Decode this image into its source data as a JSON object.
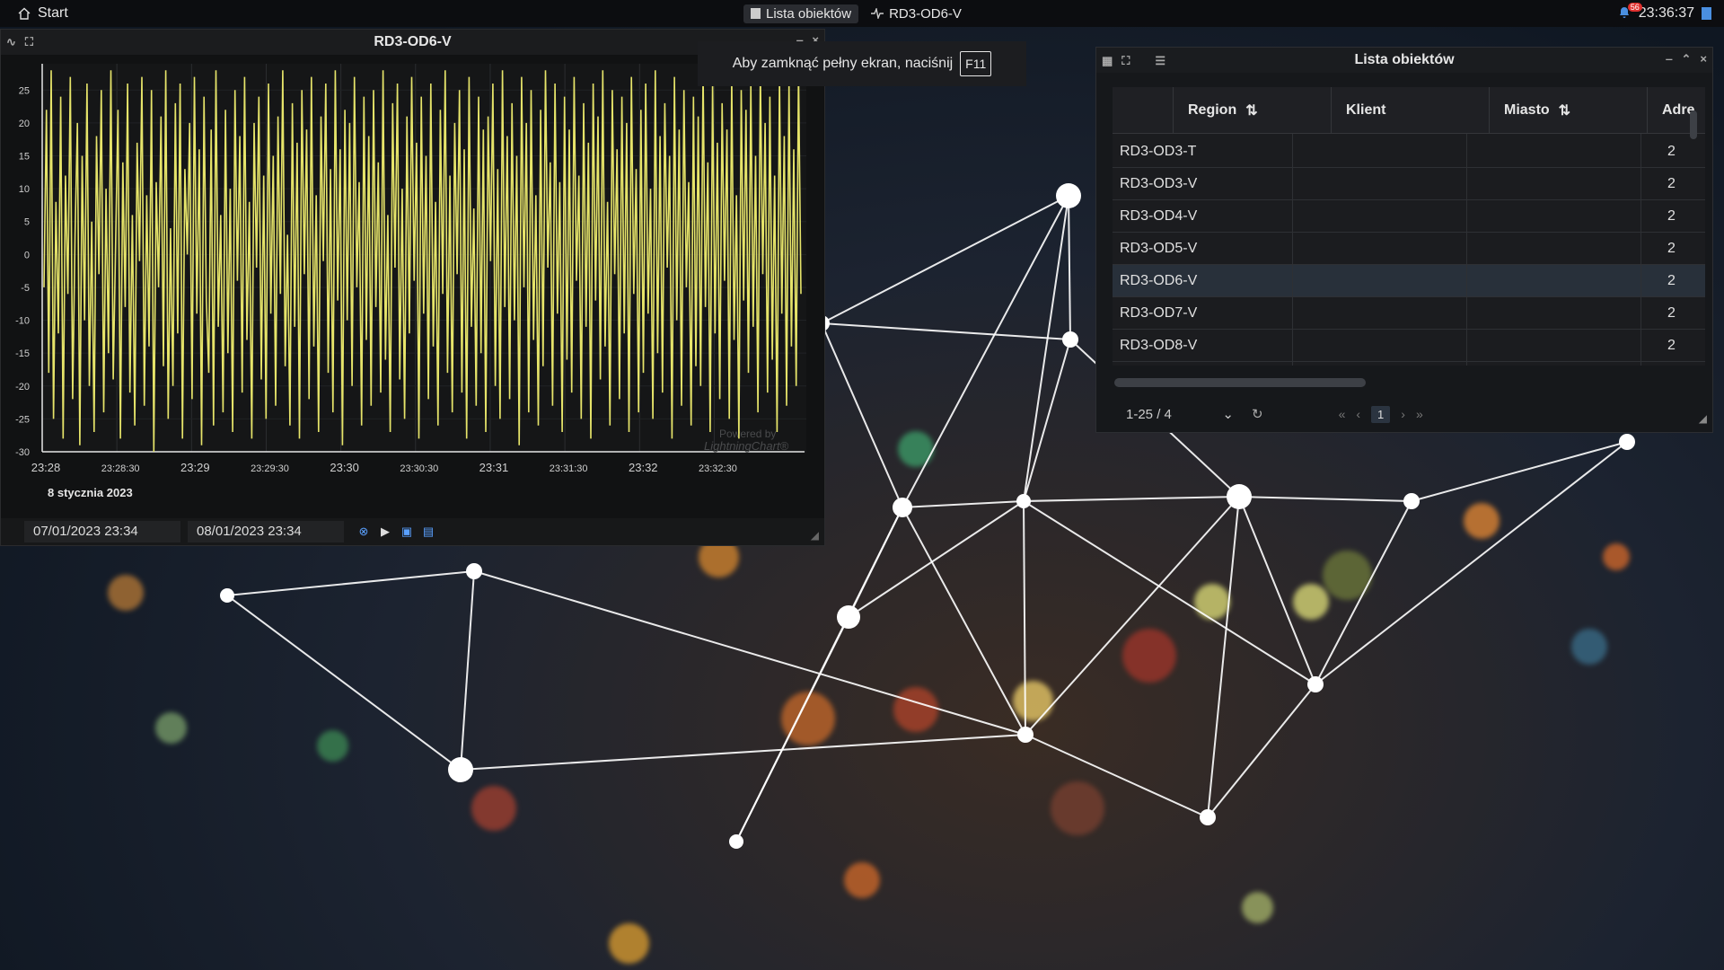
{
  "taskbar": {
    "start_label": "Start",
    "tabs": [
      {
        "label": "Lista obiektów",
        "active": true
      },
      {
        "label": "RD3-OD6-V",
        "active": false
      }
    ],
    "notification_count": "56",
    "clock": "23:36:37"
  },
  "chart_window": {
    "title": "RD3-OD6-V",
    "date_label": "8 stycznia 2023",
    "from_date": "07/01/2023 23:34",
    "to_date": "08/01/2023 23:34",
    "watermark_line1": "Powered by",
    "watermark_line2": "LightningChart®"
  },
  "toast": {
    "message": "Aby zamknąć pełny ekran, naciśnij",
    "key": "F11"
  },
  "list_window": {
    "title": "Lista obiektów",
    "columns": [
      "Region",
      "Klient",
      "Miasto",
      "Adre"
    ],
    "rows": [
      {
        "region": "RD3-OD3-T",
        "adres": "2"
      },
      {
        "region": "RD3-OD3-V",
        "adres": "2"
      },
      {
        "region": "RD3-OD4-V",
        "adres": "2"
      },
      {
        "region": "RD3-OD5-V",
        "adres": "2"
      },
      {
        "region": "RD3-OD6-V",
        "adres": "2",
        "selected": true
      },
      {
        "region": "RD3-OD7-V",
        "adres": "2"
      },
      {
        "region": "RD3-OD8-V",
        "adres": "2"
      }
    ],
    "page_size_label": "1-25 / 4",
    "current_page": "1"
  },
  "colors": {
    "series": "#e6e46a",
    "accent": "#5aa0ff",
    "badge": "#e0312f"
  },
  "chart_data": {
    "type": "line",
    "xlabel": "",
    "ylabel": "",
    "x_ticks": [
      "23:28",
      "23:28:30",
      "23:29",
      "23:29:30",
      "23:30",
      "23:30:30",
      "23:31",
      "23:31:30",
      "23:32",
      "23:32:30"
    ],
    "y_ticks": [
      25,
      20,
      15,
      10,
      5,
      0,
      -5,
      -10,
      -15,
      -20,
      -25,
      -30
    ],
    "ylim": [
      -30,
      29
    ],
    "xlim_seconds": [
      0,
      307
    ],
    "series": [
      {
        "values": [
          -5,
          22,
          -18,
          28,
          -25,
          8,
          -12,
          24,
          -28,
          12,
          -6,
          27,
          -22,
          3,
          20,
          -29,
          15,
          -10,
          26,
          -20,
          5,
          -27,
          18,
          -3,
          25,
          -24,
          10,
          -15,
          28,
          -19,
          2,
          22,
          -28,
          14,
          -8,
          26,
          -21,
          6,
          -26,
          17,
          -1,
          27,
          -23,
          9,
          -14,
          25,
          -30,
          11,
          -5,
          21,
          -17,
          28,
          -25,
          4,
          -20,
          23,
          -12,
          26,
          -28,
          13,
          0,
          20,
          -22,
          27,
          -9,
          16,
          -29,
          24,
          -7,
          -18,
          19,
          -26,
          28,
          -11,
          6,
          -24,
          22,
          -15,
          10,
          -27,
          25,
          -4,
          18,
          -21,
          27,
          -13,
          8,
          -28,
          20,
          -2,
          24,
          -19,
          12,
          -25,
          26,
          -9,
          15,
          -23,
          21,
          -6,
          28,
          -17,
          3,
          -26,
          23,
          -11,
          17,
          -28,
          25,
          -3,
          19,
          -22,
          27,
          -14,
          9,
          -27,
          21,
          -1,
          26,
          -18,
          13,
          -24,
          28,
          -7,
          16,
          -29,
          22,
          -10,
          20,
          -20,
          27,
          -5,
          11,
          -26,
          24,
          -13,
          18,
          -23,
          25,
          -8,
          14,
          -21,
          28,
          -16,
          6,
          -27,
          23,
          -2,
          26,
          -19,
          10,
          -25,
          21,
          -12,
          27,
          -4,
          17,
          -28,
          24,
          -9,
          15,
          -22,
          26,
          -14,
          8,
          -26,
          22,
          -6,
          28,
          -18,
          12,
          -24,
          20,
          -3,
          25,
          -21,
          16,
          -28,
          27,
          -11,
          7,
          -23,
          24,
          -15,
          19,
          -27,
          21,
          -1,
          26,
          -20,
          13,
          -25,
          28,
          -8,
          18,
          -22,
          23,
          -10,
          15,
          -29,
          27,
          -5,
          20,
          -24,
          25,
          -13,
          9,
          -26,
          22,
          -17,
          28,
          -2,
          14,
          -23,
          26,
          -9,
          11,
          -27,
          24,
          -16,
          19,
          -21,
          27,
          -4,
          12,
          -25,
          23,
          -11,
          17,
          -28,
          26,
          -7,
          21,
          -19,
          28,
          -14,
          8,
          -26,
          25,
          -3,
          16,
          -22,
          24,
          -12,
          20,
          -27,
          27,
          -6,
          13,
          -24,
          22,
          -18,
          26,
          -9,
          10,
          -25,
          28,
          -15,
          18,
          -21,
          23,
          -2,
          15,
          -28,
          27,
          -10,
          19,
          -23,
          25,
          -5,
          11,
          -26,
          24,
          -17,
          21,
          -20,
          28,
          -8,
          14,
          -27,
          26,
          -12,
          17,
          -22,
          23,
          -4,
          19,
          -25,
          27,
          -13,
          9,
          -28,
          25,
          -7,
          22,
          -18,
          26,
          -11,
          15,
          -24,
          28,
          -3,
          20,
          -21,
          24,
          -16,
          12,
          -27,
          27,
          -9,
          18,
          -23,
          26,
          -14,
          16,
          -20,
          28,
          -6
        ]
      }
    ]
  }
}
